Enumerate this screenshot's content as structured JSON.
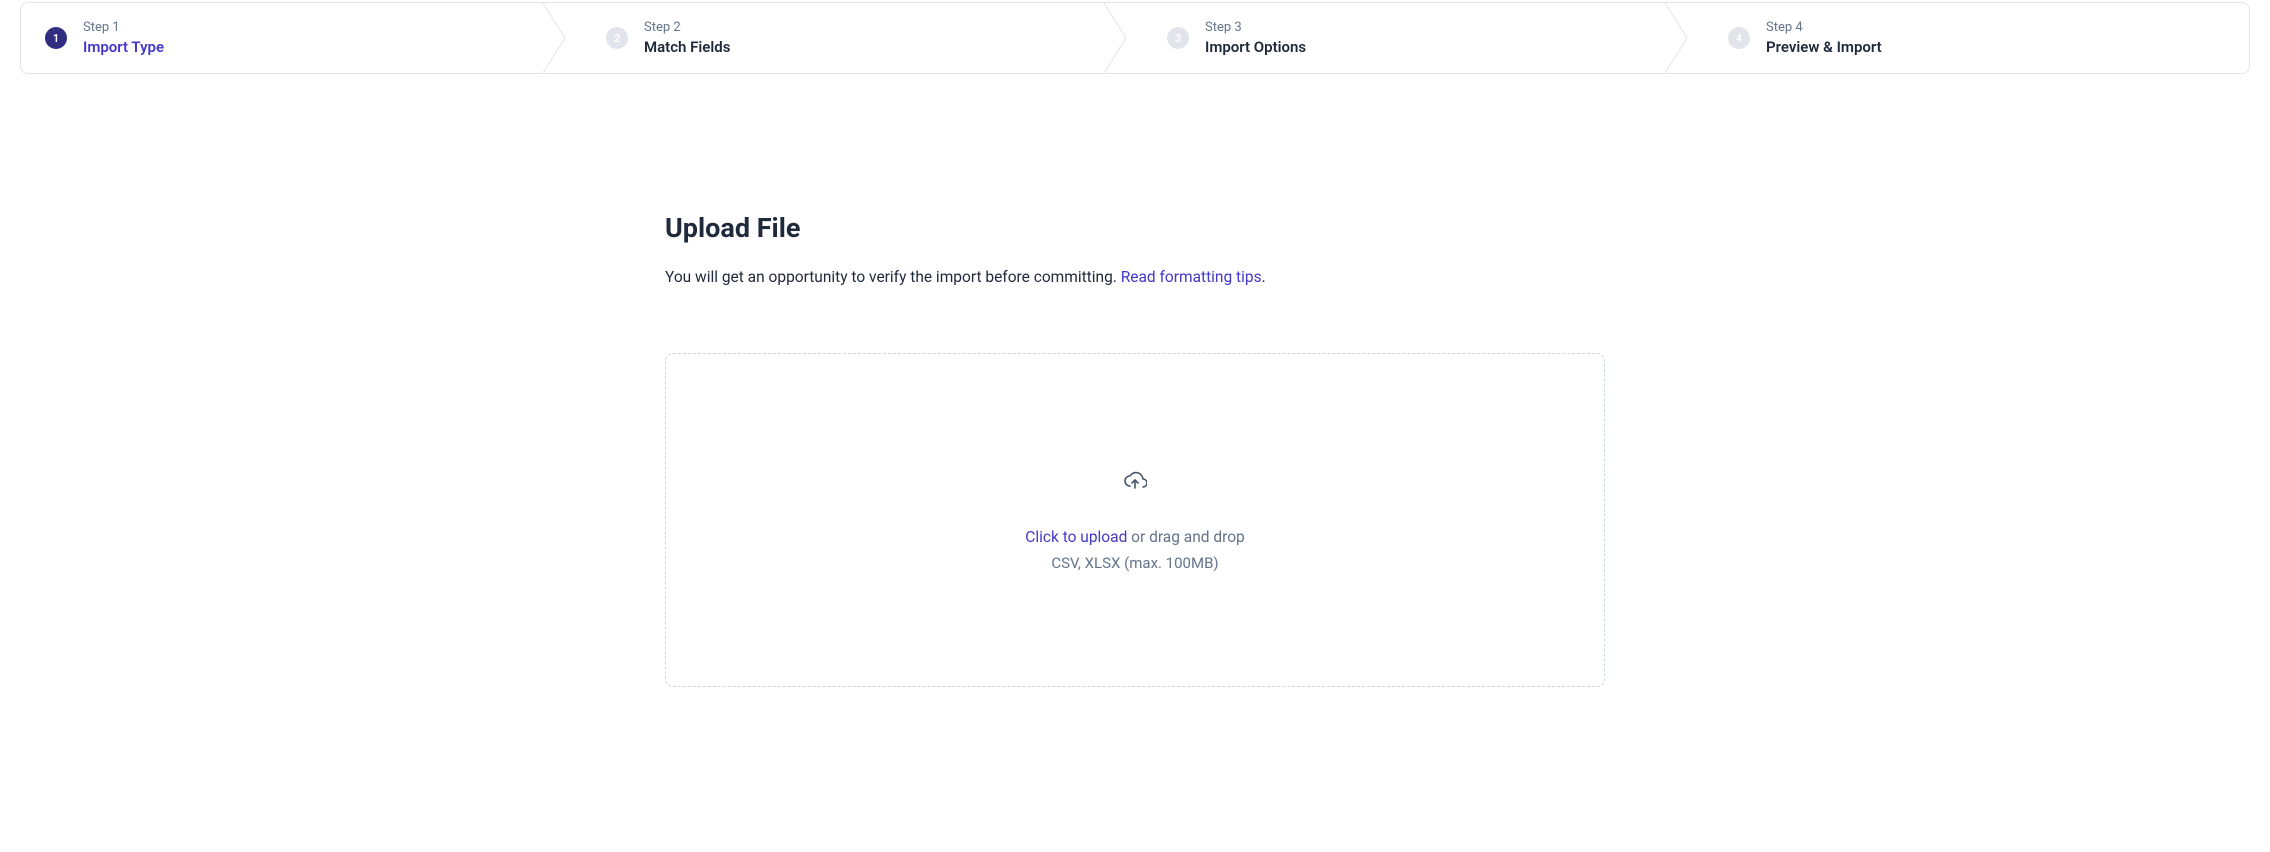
{
  "stepper": {
    "steps": [
      {
        "caption": "Step 1",
        "title": "Import Type",
        "number": "1",
        "active": true
      },
      {
        "caption": "Step 2",
        "title": "Match Fields",
        "number": "2",
        "active": false
      },
      {
        "caption": "Step 3",
        "title": "Import Options",
        "number": "3",
        "active": false
      },
      {
        "caption": "Step 4",
        "title": "Preview & Import",
        "number": "4",
        "active": false
      }
    ]
  },
  "main": {
    "title": "Upload File",
    "description_pre": "You will get an opportunity to verify the import before committing. ",
    "description_link": "Read formatting tips",
    "description_post": "."
  },
  "dropzone": {
    "click_text": "Click to upload",
    "drag_text": " or drag and drop",
    "hint": "CSV, XLSX (max. 100MB)"
  }
}
